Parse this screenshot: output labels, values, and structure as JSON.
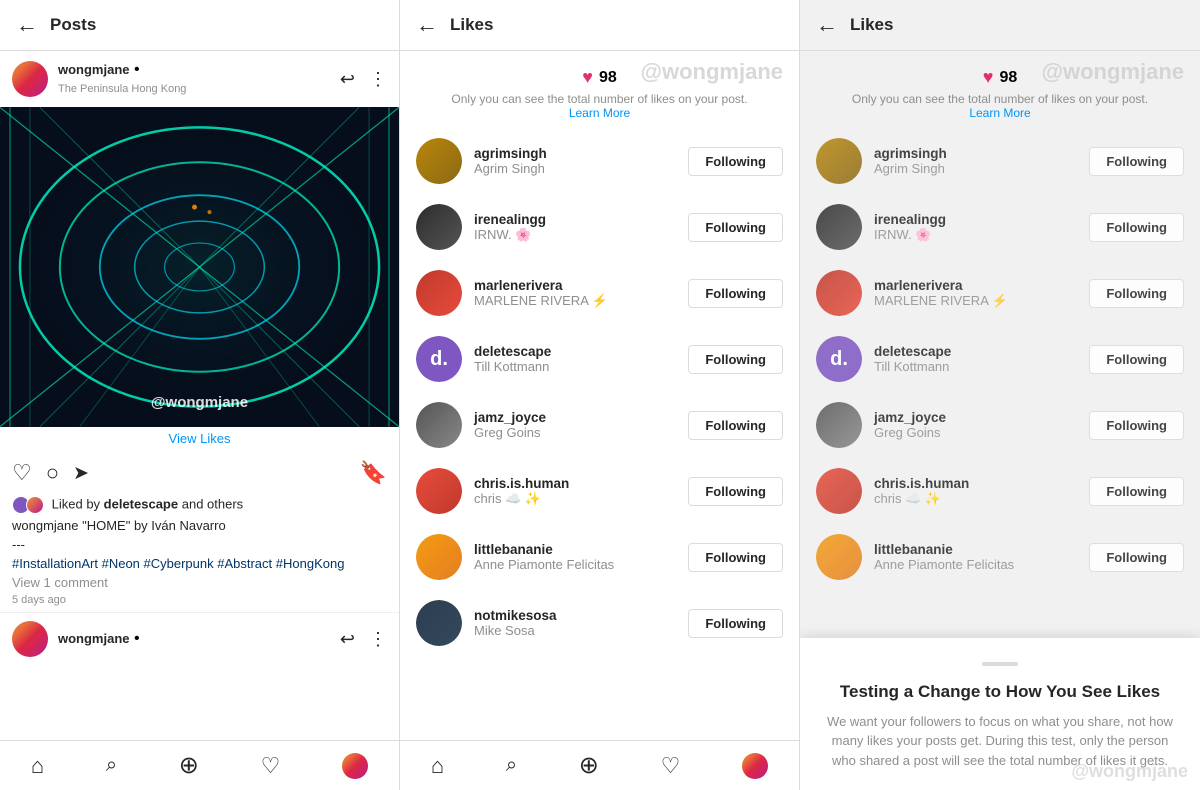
{
  "panels": {
    "posts": {
      "header": {
        "back_label": "←",
        "title": "Posts"
      },
      "post": {
        "username": "wongmjane",
        "dot": "•",
        "location": "The Peninsula Hong Kong",
        "watermark": "@wongmjane",
        "view_likes": "View Likes",
        "liked_by_text": "Liked by",
        "liked_by_user": "deletescape",
        "liked_by_suffix": " and others",
        "caption": "wongmjane \"HOME\" by Iván Navarro",
        "dash": "---",
        "hashtags": "#InstallationArt #Neon #Cyberpunk #Abstract #HongKong",
        "comments": "View 1 comment",
        "time": "5 days ago"
      },
      "nav": {
        "home": "⌂",
        "search": "🔍",
        "add": "⊕",
        "heart": "♡",
        "profile": ""
      }
    },
    "likes_mid": {
      "header": {
        "back_label": "←",
        "title": "Likes"
      },
      "stats": {
        "count": "98",
        "notice": "Only you can see the total number of likes on your post.",
        "learn_more": "Learn More",
        "watermark": "@wongmjane"
      },
      "users": [
        {
          "username": "agrimsingh",
          "display_name": "Agrim Singh",
          "avatar_class": "av-agrimsingh",
          "avatar_letter": "",
          "following": "Following"
        },
        {
          "username": "irenealingg",
          "display_name": "IRNW. 🌸",
          "avatar_class": "av-irenealingg",
          "avatar_letter": "",
          "following": "Following"
        },
        {
          "username": "marlenerivera",
          "display_name": "MARLENE RIVERA ⚡",
          "avatar_class": "av-marlenerivera",
          "avatar_letter": "",
          "following": "Following"
        },
        {
          "username": "deletescape",
          "display_name": "Till Kottmann",
          "avatar_class": "av-deletescape",
          "avatar_letter": "d.",
          "following": "Following"
        },
        {
          "username": "jamz_joyce",
          "display_name": "Greg Goins",
          "avatar_class": "av-jamzjoyce",
          "avatar_letter": "",
          "following": "Following"
        },
        {
          "username": "chris.is.human",
          "display_name": "chris ☁️ ✨",
          "avatar_class": "av-chrishuman",
          "avatar_letter": "",
          "following": "Following"
        },
        {
          "username": "littlebananie",
          "display_name": "Anne Piamonte Felicitas",
          "avatar_class": "av-littlebananie",
          "avatar_letter": "",
          "following": "Following"
        },
        {
          "username": "notmikesosa",
          "display_name": "Mike Sosa",
          "avatar_class": "av-notmikesosa",
          "avatar_letter": "",
          "following": "Following"
        }
      ]
    },
    "likes_right": {
      "header": {
        "back_label": "←",
        "title": "Likes"
      },
      "stats": {
        "count": "98",
        "notice": "Only you can see the total number of likes on your post.",
        "learn_more": "Learn More",
        "watermark": "@wongmjane"
      },
      "users": [
        {
          "username": "agrimsingh",
          "display_name": "Agrim Singh",
          "avatar_class": "av-agrimsingh",
          "avatar_letter": "",
          "following": "Following"
        },
        {
          "username": "irenealingg",
          "display_name": "IRNW. 🌸",
          "avatar_class": "av-irenealingg",
          "avatar_letter": "",
          "following": "Following"
        },
        {
          "username": "marlenerivera",
          "display_name": "MARLENE RIVERA ⚡",
          "avatar_class": "av-marlenerivera",
          "avatar_letter": "",
          "following": "Following"
        },
        {
          "username": "deletescape",
          "display_name": "Till Kottmann",
          "avatar_class": "av-deletescape",
          "avatar_letter": "d.",
          "following": "Following"
        },
        {
          "username": "jamz_joyce",
          "display_name": "Greg Goins",
          "avatar_class": "av-jamzjoyce",
          "avatar_letter": "",
          "following": "Following"
        },
        {
          "username": "chris.is.human",
          "display_name": "chris ☁️ ✨",
          "avatar_class": "av-chrishuman",
          "avatar_letter": "",
          "following": "Following"
        },
        {
          "username": "littlebananie",
          "display_name": "Anne Piamonte Felicitas",
          "avatar_class": "av-littlebananie",
          "avatar_letter": "",
          "following": "Following"
        }
      ],
      "modal": {
        "title": "Testing a Change to How You See Likes",
        "text": "We want your followers to focus on what you share, not how many likes your posts get. During this test, only the person who shared a post will see the total number of likes it gets.",
        "watermark": "@wongmjane"
      }
    }
  }
}
